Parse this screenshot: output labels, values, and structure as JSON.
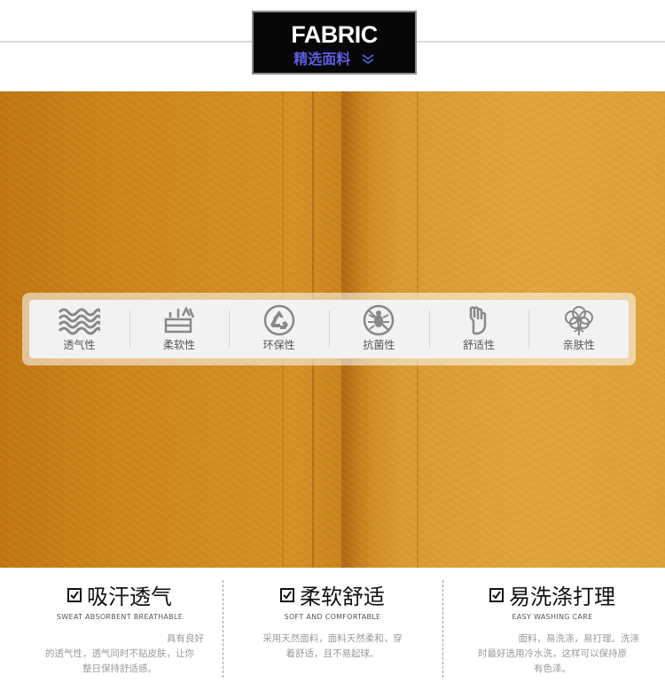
{
  "header": {
    "title": "FABRIC",
    "subtitle": "精选面料",
    "chevron_icon": "double-chevron-down-icon",
    "accent": "#5c5fe0"
  },
  "features": [
    {
      "label": "透气性",
      "icon": "waves-icon"
    },
    {
      "label": "柔软性",
      "icon": "soft-cushion-icon"
    },
    {
      "label": "环保性",
      "icon": "recycle-icon"
    },
    {
      "label": "抗菌性",
      "icon": "no-bug-icon"
    },
    {
      "label": "舒适性",
      "icon": "hand-icon"
    },
    {
      "label": "亲肤性",
      "icon": "cotton-icon"
    }
  ],
  "fabric_color": "#d08c22",
  "info": [
    {
      "title": "吸汗透气",
      "subtitle": "SWEAT ABSORBENT BREATHABLE",
      "desc": [
        "具有良好",
        "的透气性，透气同时不贴皮肤，让你",
        "整日保持舒适感。"
      ]
    },
    {
      "title": "柔软舒适",
      "subtitle": "SOFT AND COMFORTABLE",
      "desc": [
        "采用天然面料，面料天然柔和，穿",
        "着舒适，且不易起球。"
      ]
    },
    {
      "title": "易洗涤打理",
      "subtitle": "EASY WASHING CARE",
      "desc": [
        "面料，易洗涤，易打理。洗涤",
        "时最好选用冷水洗，这样可以保持原",
        "有色泽。"
      ]
    }
  ]
}
